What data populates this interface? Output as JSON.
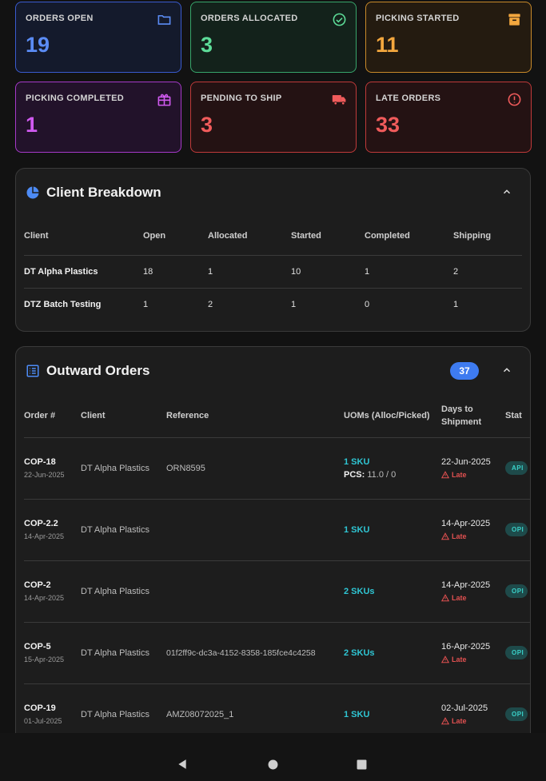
{
  "cards": [
    {
      "label": "ORDERS OPEN",
      "value": "19",
      "icon": "folder-icon",
      "color": "#5b8cf5"
    },
    {
      "label": "ORDERS ALLOCATED",
      "value": "3",
      "icon": "check-circle-icon",
      "color": "#5ddc98"
    },
    {
      "label": "PICKING STARTED",
      "value": "11",
      "icon": "archive-icon",
      "color": "#f3a73e"
    },
    {
      "label": "PICKING COMPLETED",
      "value": "1",
      "icon": "gift-icon",
      "color": "#d05af0"
    },
    {
      "label": "PENDING TO SHIP",
      "value": "3",
      "icon": "truck-icon",
      "color": "#f05b5b"
    },
    {
      "label": "LATE ORDERS",
      "value": "33",
      "icon": "alert-circle-icon",
      "color": "#f05b5b"
    }
  ],
  "client_breakdown": {
    "title": "Client Breakdown",
    "headers": [
      "Client",
      "Open",
      "Allocated",
      "Started",
      "Completed",
      "Shipping"
    ],
    "rows": [
      [
        "DT Alpha Plastics",
        "18",
        "1",
        "10",
        "1",
        "2"
      ],
      [
        "DTZ Batch Testing",
        "1",
        "2",
        "1",
        "0",
        "1"
      ]
    ]
  },
  "outward_orders": {
    "title": "Outward Orders",
    "count": "37",
    "headers": {
      "order": "Order #",
      "client": "Client",
      "reference": "Reference",
      "uoms": "UOMs (Alloc/Picked)",
      "days_line1": "Days to",
      "days_line2": "Shipment",
      "status": "Stat"
    },
    "late_label": "Late",
    "pcs_label": "PCS:",
    "rows": [
      {
        "order": "COP-18",
        "date": "22-Jun-2025",
        "client": "DT Alpha Plastics",
        "reference": "ORN8595",
        "uom": "1 SKU",
        "pcs": "11.0 / 0",
        "ship": "22-Jun-2025",
        "status": "API"
      },
      {
        "order": "COP-2.2",
        "date": "14-Apr-2025",
        "client": "DT Alpha Plastics",
        "reference": "",
        "uom": "1 SKU",
        "pcs": "",
        "ship": "14-Apr-2025",
        "status": "OPI"
      },
      {
        "order": "COP-2",
        "date": "14-Apr-2025",
        "client": "DT Alpha Plastics",
        "reference": "",
        "uom": "2 SKUs",
        "pcs": "",
        "ship": "14-Apr-2025",
        "status": "OPI"
      },
      {
        "order": "COP-5",
        "date": "15-Apr-2025",
        "client": "DT Alpha Plastics",
        "reference": "01f2ff9c-dc3a-4152-8358-185fce4c4258",
        "uom": "2 SKUs",
        "pcs": "",
        "ship": "16-Apr-2025",
        "status": "OPI"
      },
      {
        "order": "COP-19",
        "date": "01-Jul-2025",
        "client": "DT Alpha Plastics",
        "reference": "AMZ08072025_1",
        "uom": "1 SKU",
        "pcs": "",
        "ship": "02-Jul-2025",
        "status": "OPI"
      }
    ]
  }
}
